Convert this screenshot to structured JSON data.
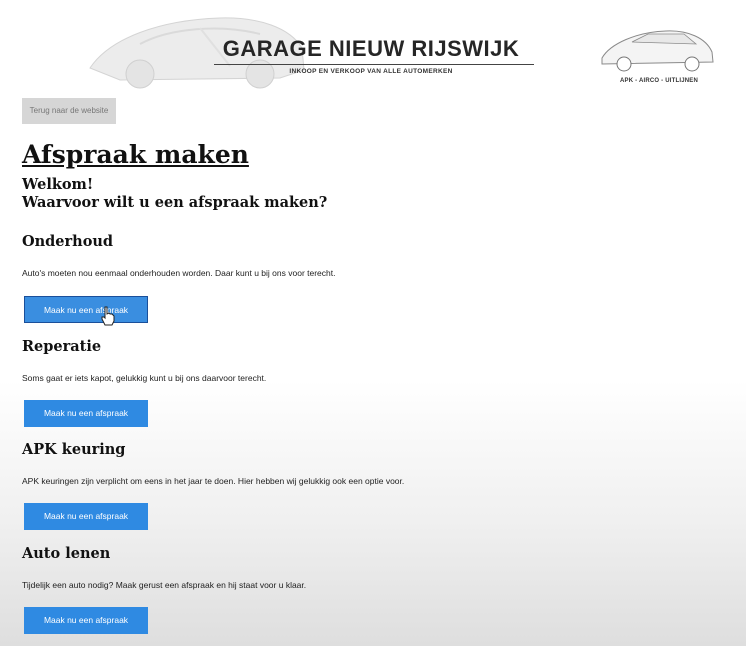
{
  "header": {
    "title": "GARAGE NIEUW RIJSWIJK",
    "subtitle": "INKOOP EN VERKOOP VAN ALLE AUTOMERKEN",
    "services": "APK - AIRCO - UITLIJNEN"
  },
  "nav": {
    "back_label": "Terug naar de website"
  },
  "page": {
    "title": "Afspraak maken",
    "welcome_line1": "Welkom!",
    "welcome_line2": "Waarvoor wilt u een afspraak maken?"
  },
  "sections": [
    {
      "title": "Onderhoud",
      "text": "Auto's moeten nou eenmaal onderhouden worden. Daar kunt u bij ons voor terecht.",
      "button": "Maak nu een afspraak"
    },
    {
      "title": "Reperatie",
      "text": "Soms gaat er iets kapot, gelukkig kunt u bij ons daarvoor terecht.",
      "button": "Maak nu een afspraak"
    },
    {
      "title": "APK keuring",
      "text": "APK keuringen zijn verplicht om eens in het jaar te doen. Hier hebben wij gelukkig ook een optie voor.",
      "button": "Maak nu een afspraak"
    },
    {
      "title": "Auto lenen",
      "text": "Tijdelijk een auto nodig? Maak gerust een afspraak en hij staat voor u klaar.",
      "button": "Maak nu een afspraak"
    }
  ],
  "colors": {
    "button": "#2f8ae2",
    "back_button": "#d6d6d6",
    "text": "#111111"
  },
  "icons": {
    "header_car": "car-silhouette",
    "cursor": "hand-pointer-icon"
  }
}
